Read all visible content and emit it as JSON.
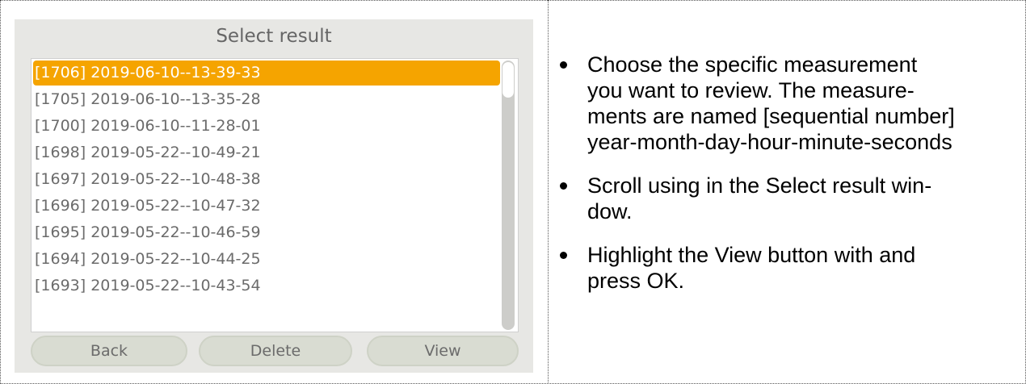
{
  "screen": {
    "title": "Select result",
    "results": [
      "[1706] 2019-06-10--13-39-33",
      "[1705] 2019-06-10--13-35-28",
      "[1700] 2019-06-10--11-28-01",
      "[1698] 2019-05-22--10-49-21",
      "[1697] 2019-05-22--10-48-38",
      "[1696] 2019-05-22--10-47-32",
      "[1695] 2019-05-22--10-46-59",
      "[1694] 2019-05-22--10-44-25",
      "[1693] 2019-05-22--10-43-54"
    ],
    "selected_index": 0,
    "buttons": {
      "back": "Back",
      "delete": "Delete",
      "view": "View"
    },
    "colors": {
      "highlight": "#f5a400",
      "panel": "#e7e7e4"
    }
  },
  "instructions": [
    {
      "lines": [
        "Choose the specific measurement",
        "you want to review. The measure-",
        "ments are named [sequential number]",
        "year-month-day-hour-minute-seconds"
      ]
    },
    {
      "lines": [
        "Scroll using   in the Select result win-",
        "dow."
      ]
    },
    {
      "lines": [
        "Highlight the View button with   and",
        "press OK."
      ]
    }
  ]
}
